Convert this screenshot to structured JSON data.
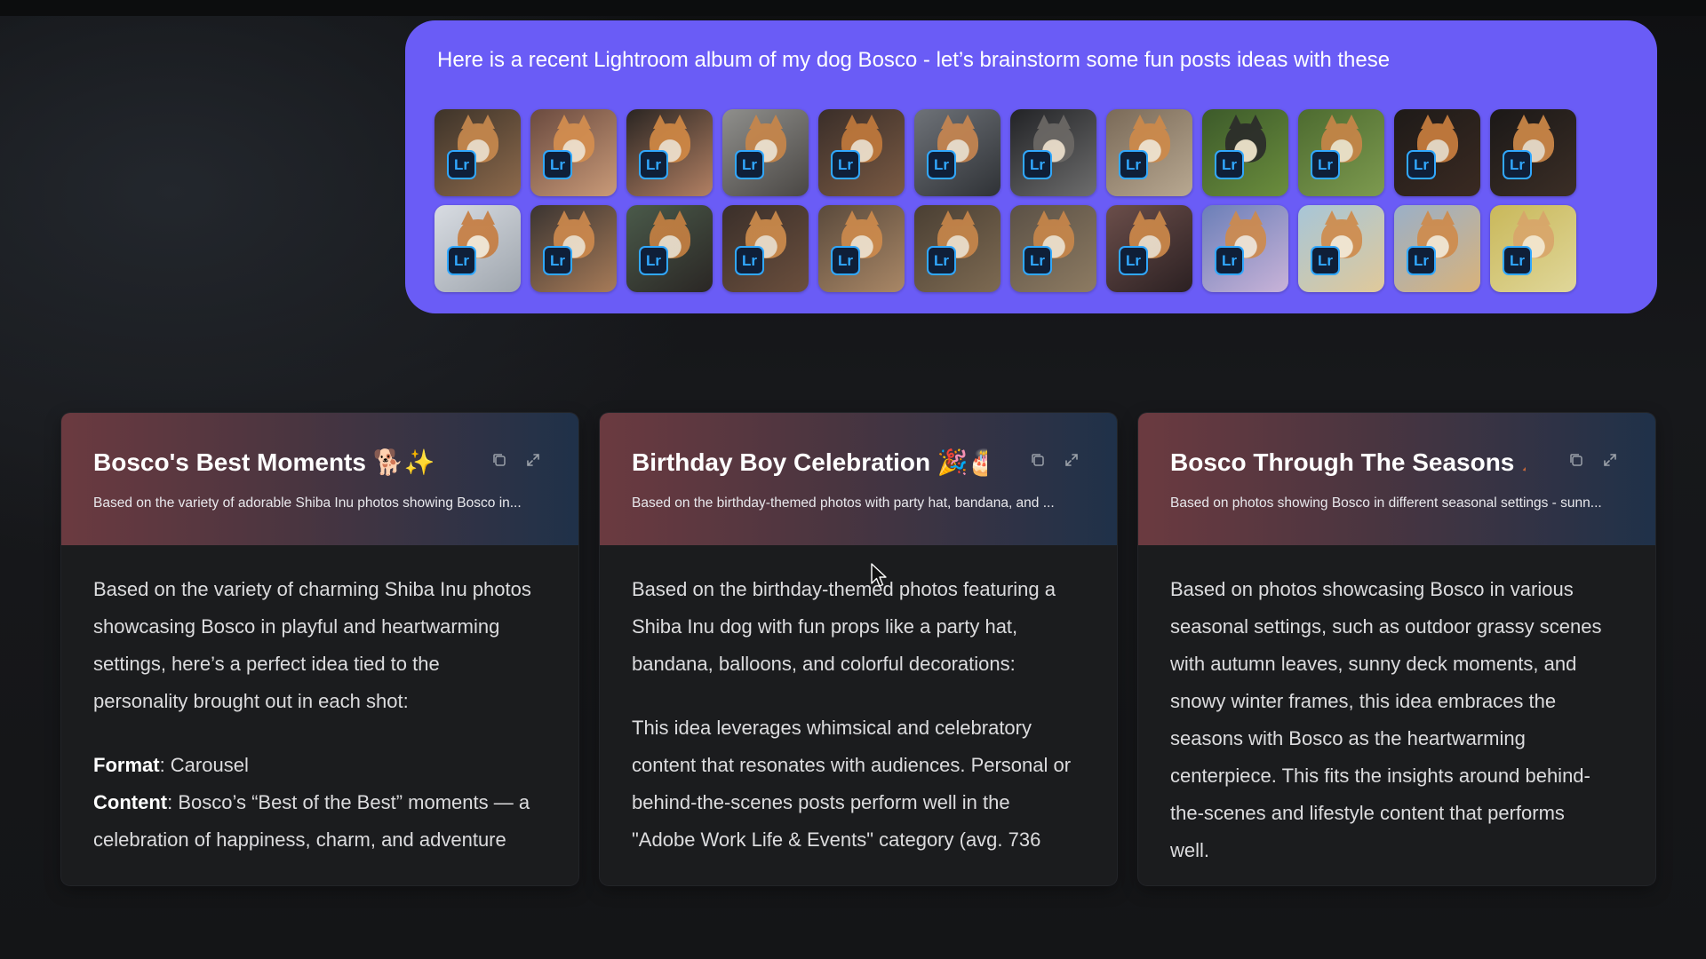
{
  "message": {
    "text": "Here is a recent Lightroom album of my dog Bosco - let’s brainstorm some fun posts ideas with these",
    "background": "#6a5cf6",
    "badge_label": "Lr",
    "badge_color": "#31a8ff",
    "thumbnails": [
      {
        "c1": "#3d3329",
        "c2": "#8d6a4c",
        "dog": "#c98a4e"
      },
      {
        "c1": "#6a4a3f",
        "c2": "#c99a78",
        "dog": "#d6904f"
      },
      {
        "c1": "#2a2522",
        "c2": "#b28063",
        "dog": "#d38a45"
      },
      {
        "c1": "#8f8f8c",
        "c2": "#4a4744",
        "dog": "#c9874a"
      },
      {
        "c1": "#3a2e29",
        "c2": "#7a5a43",
        "dog": "#c27a3c"
      },
      {
        "c1": "#6e7278",
        "c2": "#2f3236",
        "dog": "#c98750"
      },
      {
        "c1": "#222326",
        "c2": "#6d6d6d",
        "dog": "#6d6a66"
      },
      {
        "c1": "#7a6a58",
        "c2": "#b8a891",
        "dog": "#cf8a4a"
      },
      {
        "c1": "#3c5a2a",
        "c2": "#6b8d3d",
        "dog": "#2b2b2b"
      },
      {
        "c1": "#4d6b30",
        "c2": "#7d9a4f",
        "dog": "#c98549"
      },
      {
        "c1": "#1e1a18",
        "c2": "#3a2a22",
        "dog": "#cc8040"
      },
      {
        "c1": "#1b1817",
        "c2": "#3b2e26",
        "dog": "#d28b4a"
      },
      {
        "c1": "#d8dce2",
        "c2": "#9ea5ad",
        "dog": "#c67c3f"
      },
      {
        "c1": "#3a3431",
        "c2": "#a77b58",
        "dog": "#cf8a4d"
      },
      {
        "c1": "#4a5a4a",
        "c2": "#2a2624",
        "dog": "#c78142"
      },
      {
        "c1": "#3a2f2a",
        "c2": "#6b4f3d",
        "dog": "#d08d4c"
      },
      {
        "c1": "#5a4a3c",
        "c2": "#a98766",
        "dog": "#cf8b4c"
      },
      {
        "c1": "#4a3f33",
        "c2": "#7d6a52",
        "dog": "#c9874a"
      },
      {
        "c1": "#5b5146",
        "c2": "#8d7b62",
        "dog": "#c9874a"
      },
      {
        "c1": "#6b4e4a",
        "c2": "#2b2022",
        "dog": "#cf8a4a"
      },
      {
        "c1": "#6b7fb8",
        "c2": "#c9b3d8",
        "dog": "#cf8a4a"
      },
      {
        "c1": "#a7c6d8",
        "c2": "#e0c99a",
        "dog": "#cf8a4a"
      },
      {
        "c1": "#9ab0c8",
        "c2": "#d9b27a",
        "dog": "#cf8a4a"
      },
      {
        "c1": "#c9b85a",
        "c2": "#e0d79a",
        "dog": "#d8a56a"
      }
    ]
  },
  "cards": [
    {
      "title": "Bosco's Best Moments 🐕✨",
      "subtitle": "Based on the variety of adorable Shiba Inu photos showing Bosco in...",
      "paragraphs": [
        {
          "lines": [
            "Based on the variety of charming Shiba Inu photos",
            "showcasing Bosco in playful and heartwarming",
            "settings, here’s a perfect idea tied to the",
            "personality brought out in each shot:"
          ]
        }
      ],
      "format_label": "Format",
      "format_value": ": Carousel",
      "content_label": "Content",
      "content_lines": [
        ": Bosco’s “Best of the Best” moments — a",
        "celebration of happiness, charm, and adventure"
      ]
    },
    {
      "title": "Birthday Boy Celebration 🎉🎂",
      "subtitle": "Based on the birthday-themed photos with party hat, bandana, and ...",
      "paragraphs": [
        {
          "lines": [
            "Based on the birthday-themed photos featuring a",
            "Shiba Inu dog with fun props like a party hat,",
            "bandana, balloons, and colorful decorations:"
          ]
        },
        {
          "lines": [
            "This idea leverages whimsical and celebratory",
            "content that resonates with audiences. Personal or",
            "behind-the-scenes posts perform well in the",
            "\"Adobe Work Life & Events\" category (avg. 736"
          ]
        }
      ]
    },
    {
      "title": "Bosco Through The Seasons 🍂...",
      "subtitle": "Based on photos showing Bosco in different seasonal settings - sunn...",
      "paragraphs": [
        {
          "lines": [
            "Based on photos showcasing Bosco in various",
            "seasonal settings, such as outdoor grassy scenes",
            "with autumn leaves, sunny deck moments, and",
            "snowy winter frames, this idea embraces the",
            "seasons with Bosco as the heartwarming",
            "centerpiece. This fits the insights around behind-",
            "the-scenes and lifestyle content that performs",
            "well."
          ]
        }
      ]
    }
  ],
  "icons": {
    "copy": "copy-icon",
    "expand": "expand-icon"
  }
}
